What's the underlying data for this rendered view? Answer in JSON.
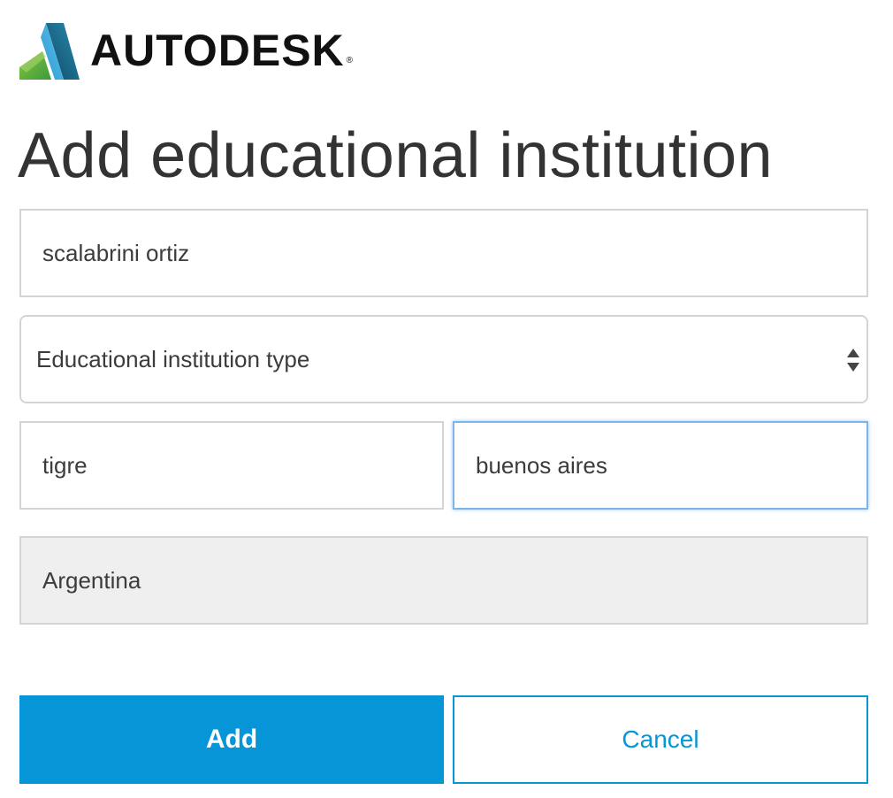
{
  "brand": {
    "name": "AUTODESK",
    "registered": "®"
  },
  "page": {
    "title": "Add educational institution"
  },
  "form": {
    "institution_name": {
      "value": "scalabrini ortiz"
    },
    "institution_type": {
      "selected": "Educational institution type"
    },
    "city": {
      "value": "tigre"
    },
    "state": {
      "value": "buenos aires"
    },
    "country": {
      "value": "Argentina"
    }
  },
  "actions": {
    "add_label": "Add",
    "cancel_label": "Cancel"
  },
  "colors": {
    "accent": "#0696d7",
    "logo_dark": "#1b5e7e",
    "logo_green": "#6cb33f",
    "disabled_bg": "#efefef"
  },
  "icons": {
    "logo": "autodesk-logo-icon",
    "select": "select-arrows-icon"
  }
}
